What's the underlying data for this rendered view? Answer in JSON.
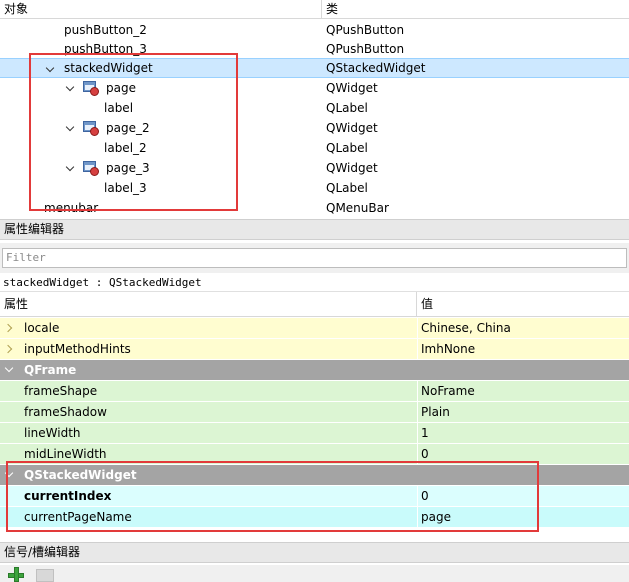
{
  "object_inspector": {
    "header": {
      "object_col": "对象",
      "class_col": "类"
    },
    "rows": [
      {
        "name": "pushButton_2",
        "cls": "QPushButton"
      },
      {
        "name": "pushButton_3",
        "cls": "QPushButton"
      },
      {
        "name": "stackedWidget",
        "cls": "QStackedWidget"
      },
      {
        "name": "page",
        "cls": "QWidget"
      },
      {
        "name": "label",
        "cls": "QLabel"
      },
      {
        "name": "page_2",
        "cls": "QWidget"
      },
      {
        "name": "label_2",
        "cls": "QLabel"
      },
      {
        "name": "page_3",
        "cls": "QWidget"
      },
      {
        "name": "label_3",
        "cls": "QLabel"
      },
      {
        "name": "menubar",
        "cls": "QMenuBar"
      }
    ]
  },
  "property_editor": {
    "title": "属性编辑器",
    "filter_placeholder": "Filter",
    "object_class": "stackedWidget : QStackedWidget",
    "header": {
      "property_col": "属性",
      "value_col": "值"
    },
    "rows": [
      {
        "name": "locale",
        "value": "Chinese, China"
      },
      {
        "name": "inputMethodHints",
        "value": "ImhNone"
      },
      {
        "group": "QFrame"
      },
      {
        "name": "frameShape",
        "value": "NoFrame"
      },
      {
        "name": "frameShadow",
        "value": "Plain"
      },
      {
        "name": "lineWidth",
        "value": "1"
      },
      {
        "name": "midLineWidth",
        "value": "0"
      },
      {
        "group": "QStackedWidget"
      },
      {
        "name": "currentIndex",
        "value": "0"
      },
      {
        "name": "currentPageName",
        "value": "page"
      }
    ]
  },
  "signal_slot_editor": {
    "title": "信号/槽编辑器"
  },
  "colors": {
    "selection": "#cde8ff",
    "highlight_box": "#e23a3a",
    "group_bg": "#a4a4a4",
    "yellow_row": "#fffdd0",
    "green_row": "#dcf5d3",
    "cyan_row": "#dbfefe"
  }
}
